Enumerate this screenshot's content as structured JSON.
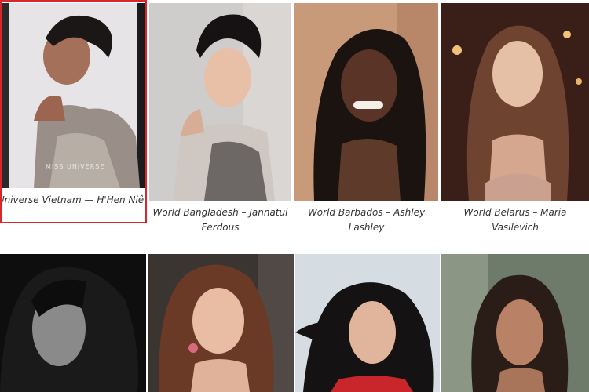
{
  "gallery": {
    "watermark": "MISS UNIVERSE",
    "items": [
      {
        "caption": "Universe Vietnam — H'Hen Niê",
        "selected": true
      },
      {
        "caption": "World Bangladesh – Jannatul Ferdous"
      },
      {
        "caption": "World Barbados – Ashley Lashley"
      },
      {
        "caption": "World Belarus – Maria Vasilevich"
      },
      {
        "caption": ""
      },
      {
        "caption": ""
      },
      {
        "caption": ""
      },
      {
        "caption": ""
      }
    ]
  },
  "colors": {
    "selection_border": "#d9262b",
    "caption_text": "#333333"
  }
}
